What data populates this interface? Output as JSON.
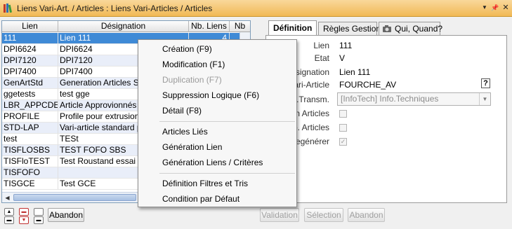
{
  "window": {
    "title": "Liens Vari-Art. / Articles : Liens Vari-Articles / Articles",
    "dropdown_glyph": "▼",
    "pin_glyph": "📌",
    "close_glyph": "✕"
  },
  "grid": {
    "columns": [
      "Lien",
      "Désignation",
      "Nb. Liens",
      "Nb"
    ],
    "rows": [
      {
        "lien": "111",
        "designation": "Lien 111",
        "nb_liens": "4"
      },
      {
        "lien": "DPI6624",
        "designation": "DPI6624",
        "nb_liens": ""
      },
      {
        "lien": "DPI7120",
        "designation": "DPI7120",
        "nb_liens": ""
      },
      {
        "lien": "DPI7400",
        "designation": "DPI7400",
        "nb_liens": ""
      },
      {
        "lien": "GenArtStd",
        "designation": "Generation Articles Stan",
        "nb_liens": ""
      },
      {
        "lien": "ggetests",
        "designation": "test gge",
        "nb_liens": ""
      },
      {
        "lien": "LBR_APPCDE",
        "designation": "Article Approvionnés à l",
        "nb_liens": ""
      },
      {
        "lien": "PROFILE",
        "designation": "Profile pour extrusion",
        "nb_liens": ""
      },
      {
        "lien": "STD-LAP",
        "designation": "Vari-article standard pou",
        "nb_liens": ""
      },
      {
        "lien": "test",
        "designation": "TESt",
        "nb_liens": ""
      },
      {
        "lien": "TISFLOSBS",
        "designation": "TEST FOFO SBS",
        "nb_liens": ""
      },
      {
        "lien": "TISFloTEST",
        "designation": "Test Roustand essai gen",
        "nb_liens": ""
      },
      {
        "lien": "TISFOFO",
        "designation": "",
        "nb_liens": ""
      },
      {
        "lien": "TISGCE",
        "designation": "Test GCE",
        "nb_liens": ""
      }
    ]
  },
  "tabs": [
    {
      "label": "Définition",
      "active": true
    },
    {
      "label": "Règles Gestion",
      "active": false
    },
    {
      "label": "Qui, Quand?",
      "active": false
    }
  ],
  "form": {
    "lien_label": "Lien",
    "lien_value": "111",
    "etat_label": "Etat",
    "etat_value": "V",
    "designation_label": "esignation",
    "designation_value": "Lien 111",
    "vari_article_label": "ari-Article",
    "vari_article_value": "FOURCHE_AV",
    "help_label": "?",
    "transm_label": "r.Transm.",
    "transm_value": "[InfoTech] Info.Techniques",
    "articles_label": "n Articles",
    "articles2_label": "p. Articles",
    "regenerer_label": "egénérer",
    "check_glyph": "✓"
  },
  "context_menu": {
    "items": [
      {
        "label": "Création (F9)",
        "disabled": false
      },
      {
        "label": "Modification (F1)",
        "disabled": false
      },
      {
        "label": "Duplication (F7)",
        "disabled": true
      },
      {
        "label": "Suppression Logique (F6)",
        "disabled": false
      },
      {
        "label": "Détail (F8)",
        "disabled": false
      },
      {
        "label": "Articles Liés",
        "disabled": false
      },
      {
        "label": "Génération Lien",
        "disabled": false
      },
      {
        "label": "Génération Liens / Critères",
        "disabled": false
      },
      {
        "label": "Définition Filtres et Tris",
        "disabled": false
      },
      {
        "label": "Condition par Défaut",
        "disabled": false
      }
    ]
  },
  "buttons": {
    "abandon_left": "Abandon",
    "validation": "Validation",
    "selection": "Sélection",
    "abandon_right": "Abandon"
  },
  "colors": {
    "title_bar": "#f1b955",
    "selection": "#3f8ad6",
    "row_alt": "#e9eef9"
  }
}
